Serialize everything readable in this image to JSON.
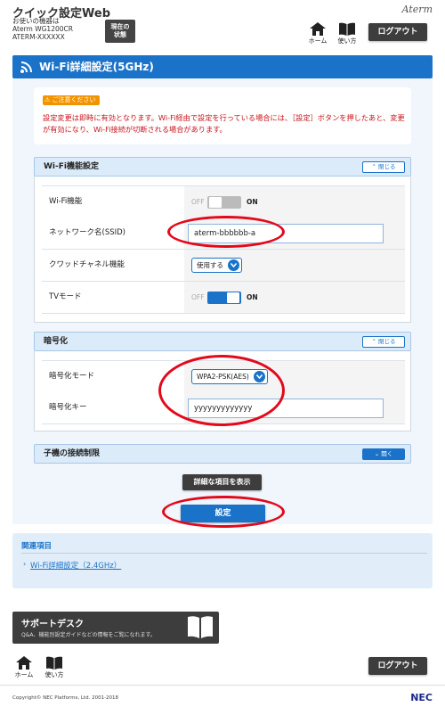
{
  "header": {
    "app_title": "クイック設定Web",
    "device_label": "お使いの機器は",
    "model_name": "Aterm WG1200CR",
    "model_id": "ATERM-XXXXXX",
    "status_button_line1": "現在の",
    "status_button_line2": "状態",
    "brand": "Aterm",
    "home_label": "ホーム",
    "help_label": "使い方",
    "logout_label": "ログアウト"
  },
  "page": {
    "title": "Wi-Fi詳細設定(5GHz)"
  },
  "notice": {
    "badge": "ご注意ください",
    "message": "設定変更は即時に有効となります。Wi-Fi経由で設定を行っている場合には、［設定］ボタンを押したあと、変更が有効になり、Wi-Fi接続が切断される場合があります。"
  },
  "wifi_section": {
    "title": "Wi-Fi機能設定",
    "toggle_label": "閉じる",
    "rows": {
      "wifi_function": {
        "label": "Wi-Fi機能",
        "off": "OFF",
        "on": "ON",
        "state": "off"
      },
      "ssid": {
        "label": "ネットワーク名(SSID)",
        "value": "aterm-bbbbbb-a"
      },
      "crowd_channel": {
        "label": "クワッドチャネル機能",
        "value": "使用する"
      },
      "tv_mode": {
        "label": "TVモード",
        "off": "OFF",
        "on": "ON",
        "state": "on"
      }
    }
  },
  "encryption_section": {
    "title": "暗号化",
    "toggle_label": "閉じる",
    "rows": {
      "mode": {
        "label": "暗号化モード",
        "value": "WPA2-PSK(AES)"
      },
      "key": {
        "label": "暗号化キー",
        "value": "yyyyyyyyyyyyy"
      }
    }
  },
  "child_section": {
    "title": "子機の接続制限",
    "toggle_label": "開く"
  },
  "buttons": {
    "show_details": "詳細な項目を表示",
    "apply": "設定"
  },
  "related": {
    "title": "関連項目",
    "link": "Wi-Fi詳細設定（2.4GHz）"
  },
  "support": {
    "title": "サポートデスク",
    "subtitle": "Q&A、機能別設定ガイドなどの情報をご覧になれます。"
  },
  "footer": {
    "home_label": "ホーム",
    "help_label": "使い方",
    "logout_label": "ログアウト",
    "copyright": "Copyright© NEC Platforms, Ltd. 2001-2018",
    "brand": "NEC"
  },
  "colors": {
    "accent": "#1b73c9",
    "notice": "#c8141e",
    "annotation": "#e3081a",
    "dark_button": "#3d3d3d"
  }
}
